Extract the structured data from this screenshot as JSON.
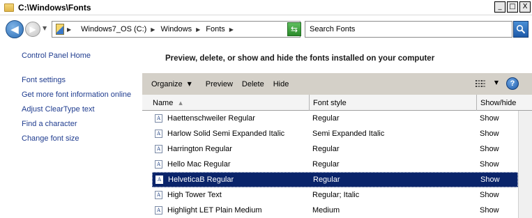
{
  "window": {
    "title": "C:\\Windows\\Fonts"
  },
  "title_controls": {
    "minimize": "_",
    "maximize": "□",
    "close": "X"
  },
  "address": {
    "breadcrumbs": [
      "Windows7_OS (C:)",
      "Windows",
      "Fonts"
    ],
    "search_placeholder": "Search Fonts"
  },
  "sidebar": {
    "items": [
      {
        "label": "Control Panel Home"
      },
      {
        "label": "Font settings"
      },
      {
        "label": "Get more font information online"
      },
      {
        "label": "Adjust ClearType text"
      },
      {
        "label": "Find a character"
      },
      {
        "label": "Change font size"
      }
    ]
  },
  "main": {
    "heading": "Preview, delete, or show and hide the fonts installed on your computer"
  },
  "toolbar": {
    "organize": "Organize",
    "preview": "Preview",
    "delete": "Delete",
    "hide": "Hide",
    "help": "?"
  },
  "columns": {
    "name": "Name",
    "style": "Font style",
    "show": "Show/hide"
  },
  "fonts": [
    {
      "name": "Haettenschweiler Regular",
      "style": "Regular",
      "show": "Show"
    },
    {
      "name": "Harlow Solid Semi Expanded Italic",
      "style": "Semi Expanded Italic",
      "show": "Show"
    },
    {
      "name": "Harrington Regular",
      "style": "Regular",
      "show": "Show"
    },
    {
      "name": "Hello Mac Regular",
      "style": "Regular",
      "show": "Show"
    },
    {
      "name": "HelveticaB Regular",
      "style": "Regular",
      "show": "Show",
      "selected": true
    },
    {
      "name": "High Tower Text",
      "style": "Regular; Italic",
      "show": "Show"
    },
    {
      "name": "Highlight LET Plain Medium",
      "style": "Medium",
      "show": "Show"
    }
  ],
  "colors": {
    "selection": "#0a246a",
    "link": "#1f3c8f",
    "toolbar": "#d4d0c8"
  },
  "icons": {
    "back": "back-arrow-icon",
    "forward": "forward-arrow-icon",
    "refresh": "refresh-icon",
    "search": "search-icon",
    "help": "help-icon",
    "views": "view-list-icon",
    "font": "font-file-icon"
  }
}
